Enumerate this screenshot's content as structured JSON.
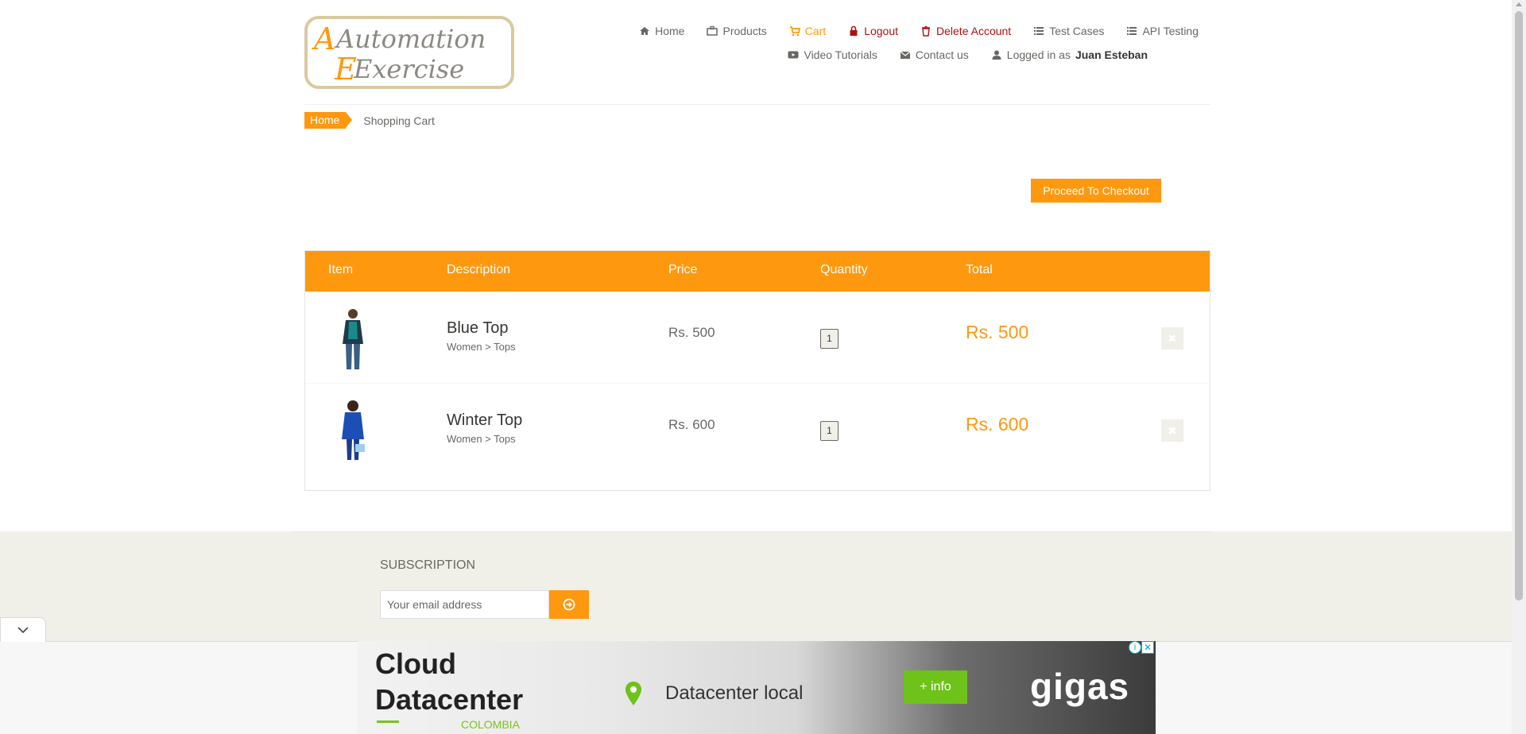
{
  "logo": {
    "line1": "Automation",
    "line2": "Exercise"
  },
  "nav": {
    "row1": [
      {
        "label": "Home",
        "icon": "home-icon"
      },
      {
        "label": "Products",
        "icon": "briefcase-icon"
      },
      {
        "label": "Cart",
        "icon": "shopping-cart-icon"
      },
      {
        "label": "Logout",
        "icon": "lock-icon"
      },
      {
        "label": "Delete Account",
        "icon": "trash-icon"
      },
      {
        "label": "Test Cases",
        "icon": "list-icon"
      },
      {
        "label": "API Testing",
        "icon": "list-icon"
      }
    ],
    "row2": [
      {
        "label": "Video Tutorials",
        "icon": "youtube-play-icon"
      },
      {
        "label": "Contact us",
        "icon": "envelope-icon"
      },
      {
        "label": "Logged in as",
        "icon": "user-icon",
        "user": "Juan Esteban"
      }
    ]
  },
  "breadcrumb": {
    "home": "Home",
    "current": "Shopping Cart"
  },
  "checkout": {
    "label": "Proceed To Checkout"
  },
  "cart": {
    "headers": [
      "Item",
      "Description",
      "Price",
      "Quantity",
      "Total"
    ],
    "items": [
      {
        "name": "Blue Top",
        "category": "Women > Tops",
        "price": "Rs. 500",
        "quantity": "1",
        "total": "Rs. 500"
      },
      {
        "name": "Winter Top",
        "category": "Women > Tops",
        "price": "Rs. 600",
        "quantity": "1",
        "total": "Rs. 600"
      }
    ]
  },
  "subscription": {
    "title": "SUBSCRIPTION",
    "placeholder": "Your email address"
  },
  "ad": {
    "title_line1": "Cloud",
    "title_line2": "Datacenter",
    "country": "COLOMBIA",
    "location": "Datacenter local",
    "cta": "+ info",
    "brand": "gigas"
  },
  "colors": {
    "accent": "#fe980f",
    "danger": "#ae1111",
    "ad_green": "#6ec219"
  }
}
